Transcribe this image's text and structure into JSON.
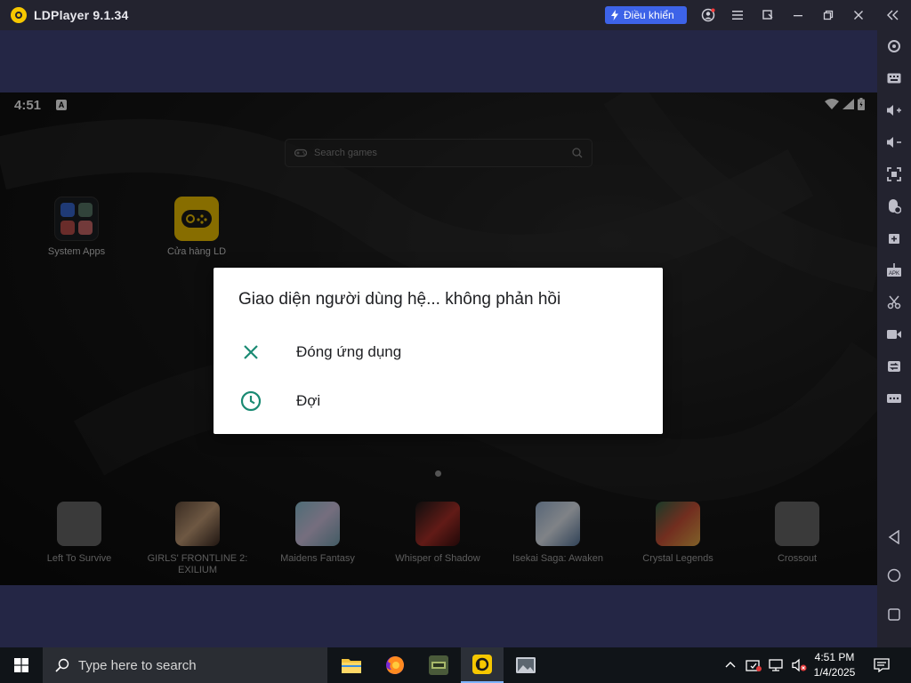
{
  "window": {
    "title": "LDPlayer 9.1.34",
    "control_label": "Điều khiển"
  },
  "android": {
    "status_time": "4:51",
    "status_badge": "A",
    "search_placeholder": "Search games",
    "home_icons": [
      {
        "label": "System Apps"
      },
      {
        "label": "Cửa hàng LD"
      }
    ],
    "dock_apps": [
      {
        "label": "Left To Survive"
      },
      {
        "label": "GIRLS' FRONTLINE 2: EXILIUM"
      },
      {
        "label": "Maidens Fantasy"
      },
      {
        "label": "Whisper of Shadow"
      },
      {
        "label": "Isekai Saga: Awaken"
      },
      {
        "label": "Crystal Legends"
      },
      {
        "label": "Crossout"
      }
    ]
  },
  "dialog": {
    "title": "Giao diện người dùng hệ... không phản hồi",
    "options": [
      {
        "label": "Đóng ứng dụng",
        "icon": "close-icon"
      },
      {
        "label": "Đợi",
        "icon": "clock-icon"
      }
    ],
    "accent": "#1a8a73"
  },
  "taskbar": {
    "search_placeholder": "Type here to search",
    "time": "4:51 PM",
    "date": "1/4/2025"
  },
  "colors": {
    "brand": "#f6c700",
    "control_button": "#3d63e8"
  }
}
